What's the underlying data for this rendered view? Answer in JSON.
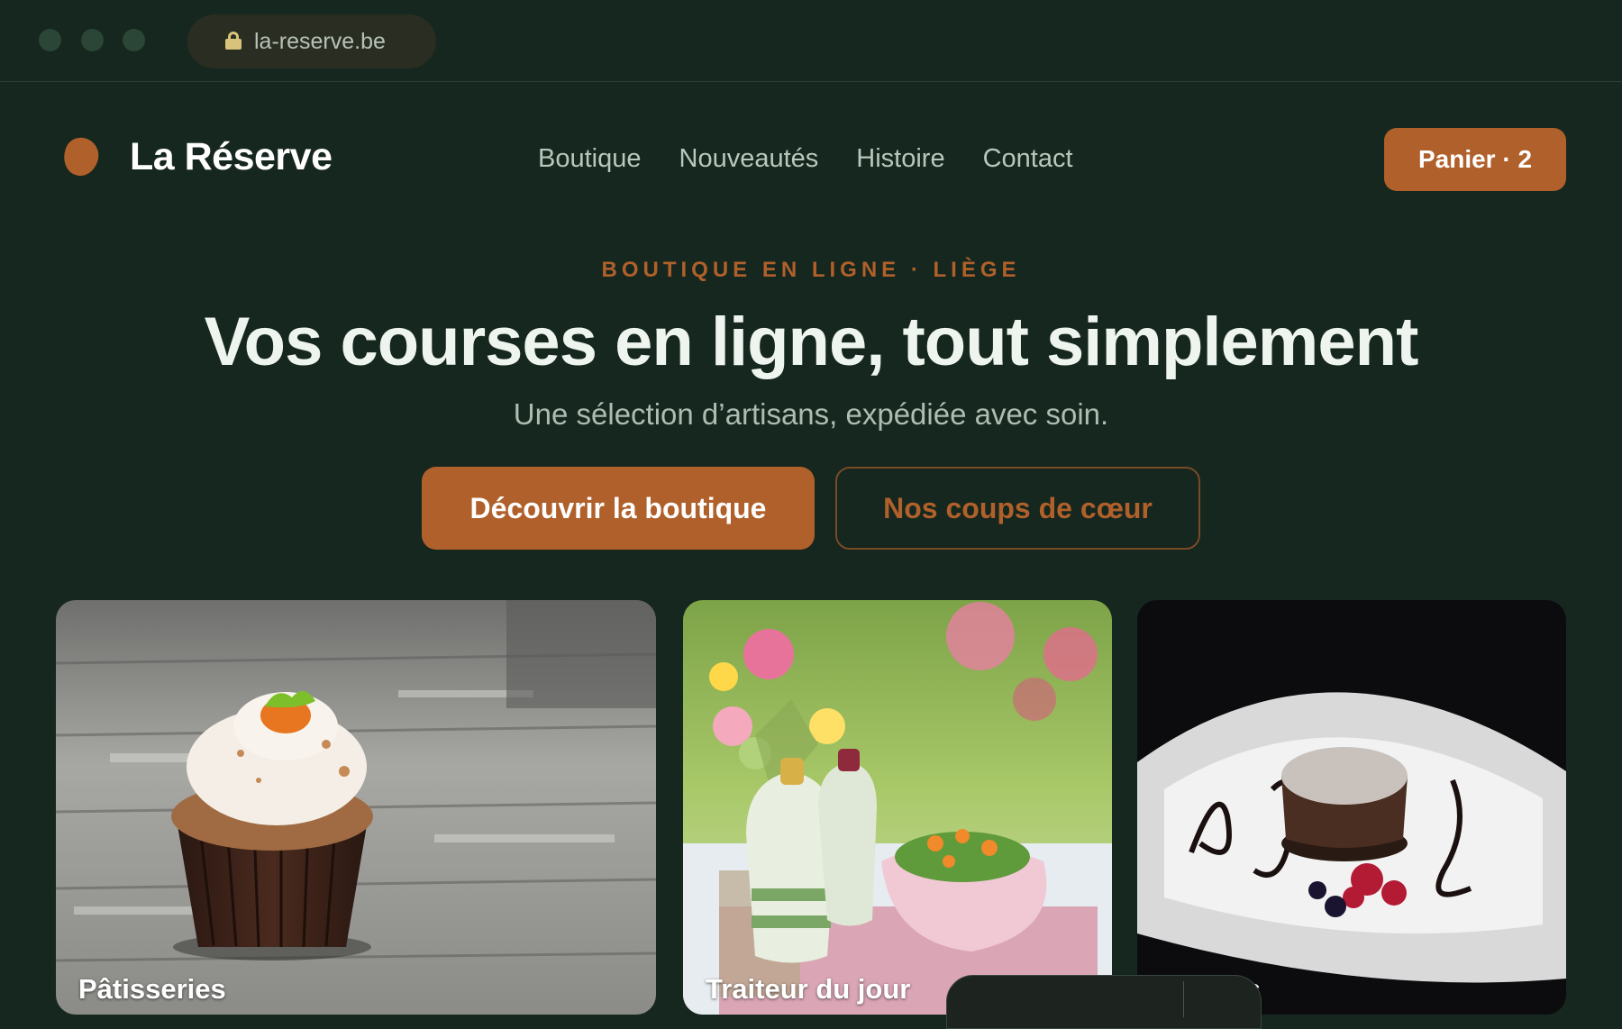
{
  "browser": {
    "url": "la-reserve.be"
  },
  "header": {
    "brand": "La Réserve",
    "nav": [
      "Boutique",
      "Nouveautés",
      "Histoire",
      "Contact"
    ],
    "cart_label": "Panier · 2"
  },
  "hero": {
    "eyebrow": "BOUTIQUE EN LIGNE · LIÈGE",
    "title": "Vos courses en ligne, tout simplement",
    "subtitle": "Une sélection d’artisans, expédiée avec soin.",
    "primary_cta": "Découvrir la boutique",
    "secondary_cta": "Nos coups de cœur"
  },
  "categories": [
    {
      "label": "Pâtisseries"
    },
    {
      "label": "Traiteur du jour"
    },
    {
      "label": "réparés"
    }
  ],
  "colors": {
    "background": "#15271e",
    "accent": "#b0602a",
    "text": "#eef4ee",
    "muted": "#b9c7bd"
  }
}
